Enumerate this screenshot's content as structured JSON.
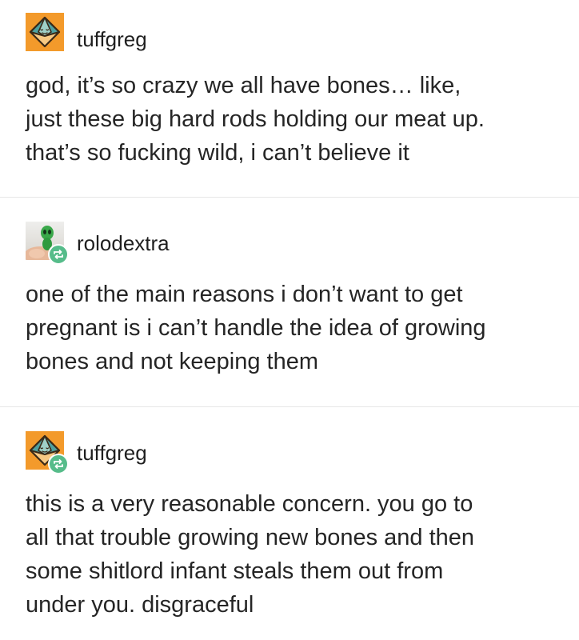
{
  "posts": [
    {
      "username": "tuffgreg",
      "avatar": "octahedron-d8-icon",
      "reblog": false,
      "lines": [
        "god, it’s so crazy we all have bones… like,",
        "just these big hard rods holding our meat up.",
        "that’s so fucking wild, i can’t believe it"
      ]
    },
    {
      "username": "rolodextra",
      "avatar": "green-alien-toy-photo",
      "reblog": true,
      "lines": [
        "one of the main reasons i don’t want to get",
        "pregnant is i can’t handle the idea of growing",
        "bones and not keeping them"
      ]
    },
    {
      "username": "tuffgreg",
      "avatar": "octahedron-d8-icon",
      "reblog": true,
      "lines": [
        "this is a very reasonable concern. you go to",
        "all that trouble growing new bones and then",
        "some shitlord infant steals them out from",
        "under you. disgraceful"
      ]
    }
  ],
  "colors": {
    "avatar_orange": "#f39a2b",
    "reblog_green": "#56bc8a",
    "divider": "#e6e6e6"
  }
}
